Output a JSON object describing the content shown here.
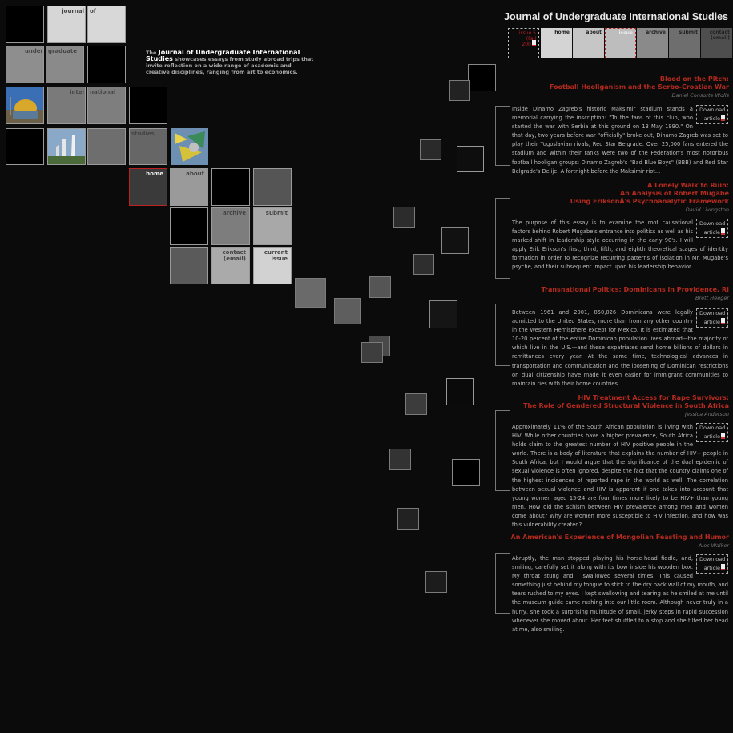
{
  "site": {
    "title": "Journal of Undergraduate International Studies"
  },
  "intro": {
    "the": "The",
    "journal": "Journal of Undergraduate International Studies",
    "text": "showcases essays from study abroad trips that invite reflection on a wide range of academic and creative disciplines, ranging from art to economics."
  },
  "mosaic": {
    "journal": "journal",
    "of": "of",
    "under": "under",
    "graduate": "graduate",
    "inter": "inter",
    "national": "national",
    "studies": "studies"
  },
  "mosaic_nav": {
    "home": "home",
    "about": "about",
    "archive": "archive",
    "submit": "submit",
    "contact": "contact (email)",
    "current_issue": "current issue"
  },
  "topnav": {
    "issue": "issue 5 (Fall 2007)",
    "home": "home",
    "about": "about",
    "blank": "issue",
    "archive": "archive",
    "submit": "submit",
    "contact": "contact (email)"
  },
  "download_label": [
    "Download",
    "article"
  ],
  "articles": [
    {
      "title": "Blood on the Pitch: Football Hooliganism and the Serbo-Croatian War",
      "title_lines": [
        "Blood on the Pitch:",
        "Football Hooliganism and the Serbo-Croatian War"
      ],
      "author": "Daniel Consorte Wolls",
      "body": "Inside Dinamo Zagreb's historic Maksimir stadium stands a memorial carrying the inscription: \"To the fans of this club, who started the war with Serbia at this ground on 13 May 1990.\" On that day, two years before war \"officially\" broke out, Dinamo Zagreb was set to play their Yugoslavian rivals, Red Star Belgrade. Over 25,000 fans entered the stadium and within their ranks were two of the Federation's most notorious football hooligan groups: Dinamo Zagreb's \"Bad Blue Boys\" (BBB) and Red Star Belgrade's Delije. A fortnight before the Maksimir riot..."
    },
    {
      "title_lines": [
        "A Lonely Walk to Ruin:",
        "An Analysis of Robert Mugabe",
        "Using EriksonÂ's Psychoanalytic Framework"
      ],
      "author": "David Livingston",
      "body": "The purpose of this essay is to examine the root causational factors behind Robert Mugabe's entrance into politics as well as his marked shift in leadership style occurring in the early 90's. I will apply Erik Erikson's first, third, fifth, and eighth theoretical stages of identity formation in order to recognize recurring patterns of isolation in Mr. Mugabe's psyche, and their subsequent impact upon his leadership behavior."
    },
    {
      "title_lines": [
        "Transnational Politics: Dominicans in Providence, RI"
      ],
      "author": "Brett Heeger",
      "body": "Between 1961 and 2001, 850,026 Dominicans were legally admitted to the United States, more than from any other country in the Western Hemisphere except for Mexico. It is estimated that 10-20 percent of the entire Dominican population lives abroad—the majority of which live in the U.S.—and these expatriates send home billions of dollars in remittances every year. At the same time, technological advances in transportation and communication and the loosening of Dominican restrictions on dual citizenship have made it even easier for immigrant communities to maintain ties with their home countries..."
    },
    {
      "title_lines": [
        "HIV Treatment Access for Rape Survivors:",
        "The Role of Gendered Structural Violence in South Africa"
      ],
      "author": "Jessica Anderson",
      "body": "Approximately 11% of the South African population is living with HIV. While other countries have a higher prevalence, South Africa holds claim to the greatest number of HIV positive people in the world. There is a body of literature that explains the number of HIV+ people in South Africa, but I would argue that the significance of the dual epidemic of sexual violence is often ignored, despite the fact that the country claims one of the highest incidences of reported rape in the world as well. The correlation between sexual violence and HIV is apparent if one takes into account that young women aged 15-24 are four times more likely to be HIV+ than young men. How did the schism between HIV prevalence among men and women come about? Why are women more susceptible to HIV infection, and how was this vulnerability created?"
    },
    {
      "title_lines": [
        "An American's Experience of Mongolian Feasting and Humor"
      ],
      "author": "Alec Walker",
      "body": "Abruptly, the man stopped playing his horse-head fiddle, and, smiling, carefully set it along with its bow inside his wooden box. My throat stung and I swallowed several times. This caused something just behind my tongue to stick to the dry back wall of my mouth, and tears rushed to my eyes. I kept swallowing and tearing as he smiled at me until the museum guide came rushing into our little room. Although never truly in a hurry, she took a surprising multitude of small, jerky steps in rapid succession whenever she moved about. Her feet shuffled to a stop and she tilted her head at me, also smiling."
    }
  ]
}
